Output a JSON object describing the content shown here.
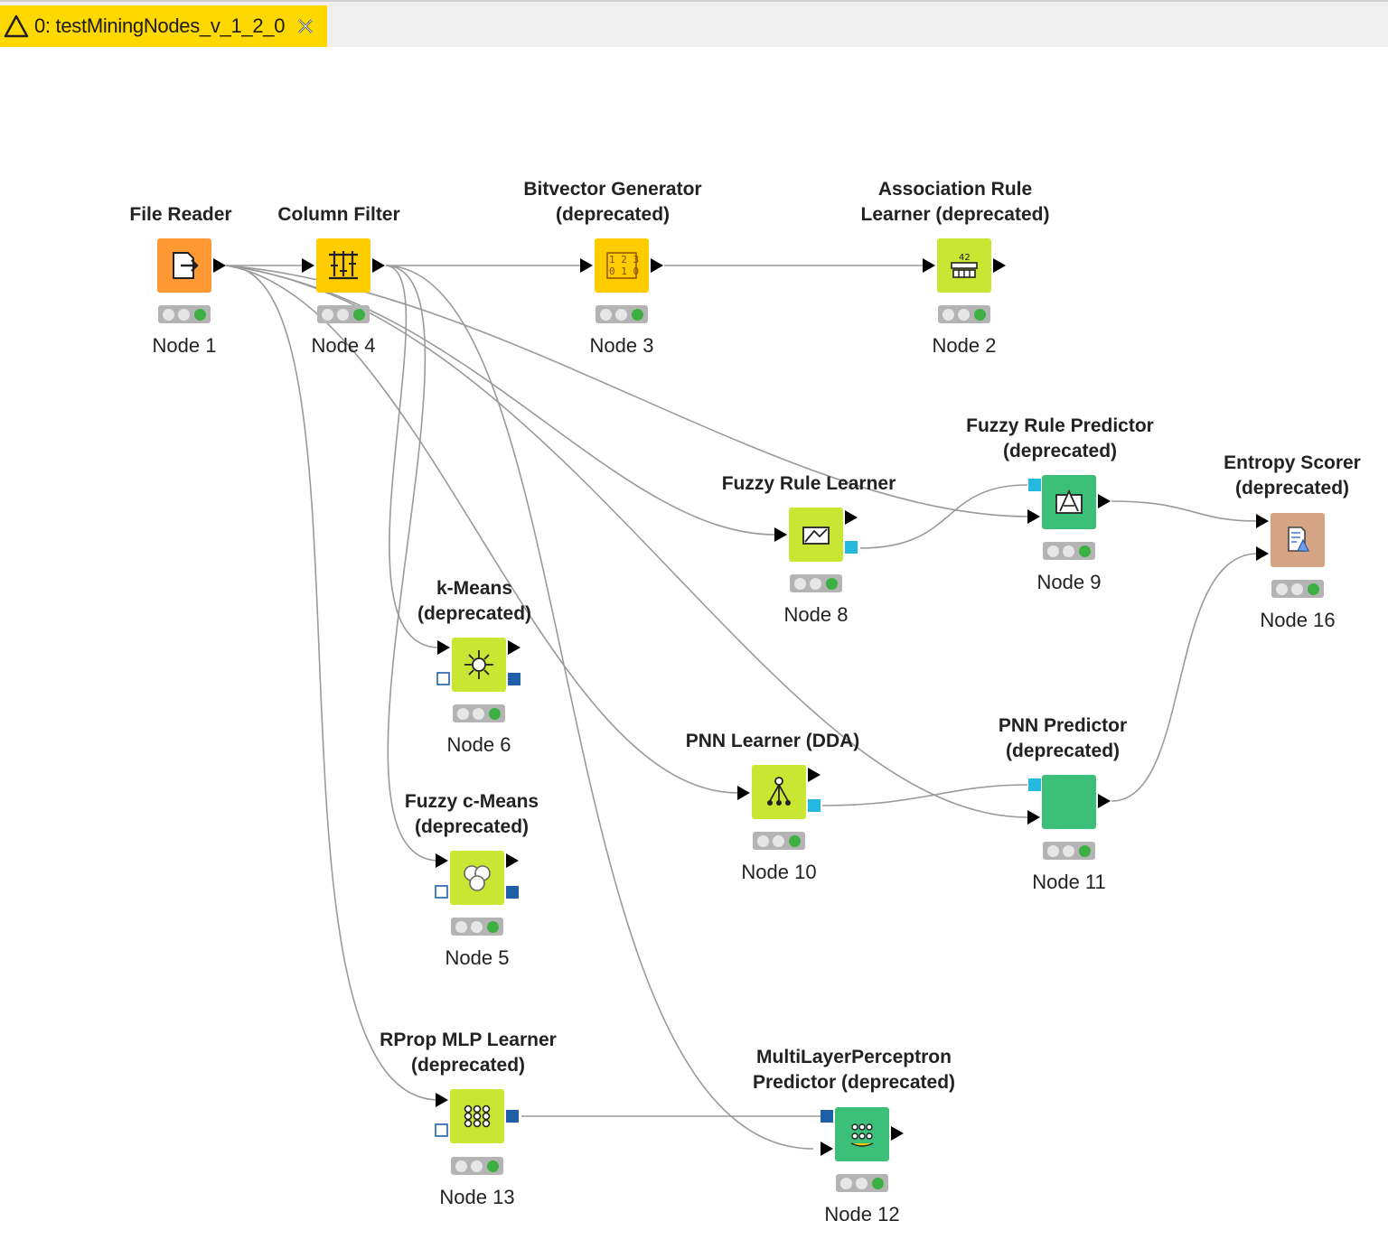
{
  "tab": {
    "title": "0: testMiningNodes_v_1_2_0",
    "warning_icon": "warning-triangle-icon",
    "close_icon": "close-icon"
  },
  "colors": {
    "tab_bg": "#ffd800",
    "reader": "#ff9933",
    "manipulator": "#ffcc00",
    "learner": "#c8e632",
    "predictor": "#3cbf78",
    "scorer": "#d4a484",
    "flow_port": "#000000",
    "model_port_light": "#25b8e0",
    "model_port_dark": "#1f5fa8",
    "connection": "#9a9a9a",
    "status_ok": "#3cb043"
  },
  "nodes": [
    {
      "id": "node1",
      "title": "File Reader",
      "label": "Node 1",
      "kind": "reader",
      "icon": "file-reader-icon"
    },
    {
      "id": "node4",
      "title": "Column Filter",
      "label": "Node 4",
      "kind": "manipulator",
      "icon": "column-filter-icon"
    },
    {
      "id": "node3",
      "title": "Bitvector Generator\n(deprecated)",
      "label": "Node 3",
      "kind": "manipulator",
      "icon": "bitvector-icon"
    },
    {
      "id": "node2",
      "title": "Association Rule\nLearner (deprecated)",
      "label": "Node 2",
      "kind": "learner",
      "icon": "association-rule-icon"
    },
    {
      "id": "node8",
      "title": "Fuzzy Rule Learner",
      "label": "Node 8",
      "kind": "learner",
      "icon": "fuzzy-rule-icon"
    },
    {
      "id": "node9",
      "title": "Fuzzy Rule Predictor\n(deprecated)",
      "label": "Node 9",
      "kind": "predictor",
      "icon": "fuzzy-predictor-icon"
    },
    {
      "id": "node16",
      "title": "Entropy Scorer\n(deprecated)",
      "label": "Node 16",
      "kind": "scorer",
      "icon": "entropy-scorer-icon"
    },
    {
      "id": "node6",
      "title": "k-Means\n(deprecated)",
      "label": "Node 6",
      "kind": "learner",
      "icon": "kmeans-icon"
    },
    {
      "id": "node10",
      "title": "PNN Learner (DDA)",
      "label": "Node 10",
      "kind": "learner",
      "icon": "pnn-learner-icon"
    },
    {
      "id": "node11",
      "title": "PNN Predictor\n(deprecated)",
      "label": "Node 11",
      "kind": "predictor",
      "icon": ""
    },
    {
      "id": "node5",
      "title": "Fuzzy c-Means\n(deprecated)",
      "label": "Node 5",
      "kind": "learner",
      "icon": "fuzzy-cmeans-icon"
    },
    {
      "id": "node13",
      "title": "RProp MLP Learner\n(deprecated)",
      "label": "Node 13",
      "kind": "learner",
      "icon": "mlp-learner-icon"
    },
    {
      "id": "node12",
      "title": "MultiLayerPerceptron\nPredictor (deprecated)",
      "label": "Node 12",
      "kind": "predictor",
      "icon": "mlp-predictor-icon"
    }
  ]
}
